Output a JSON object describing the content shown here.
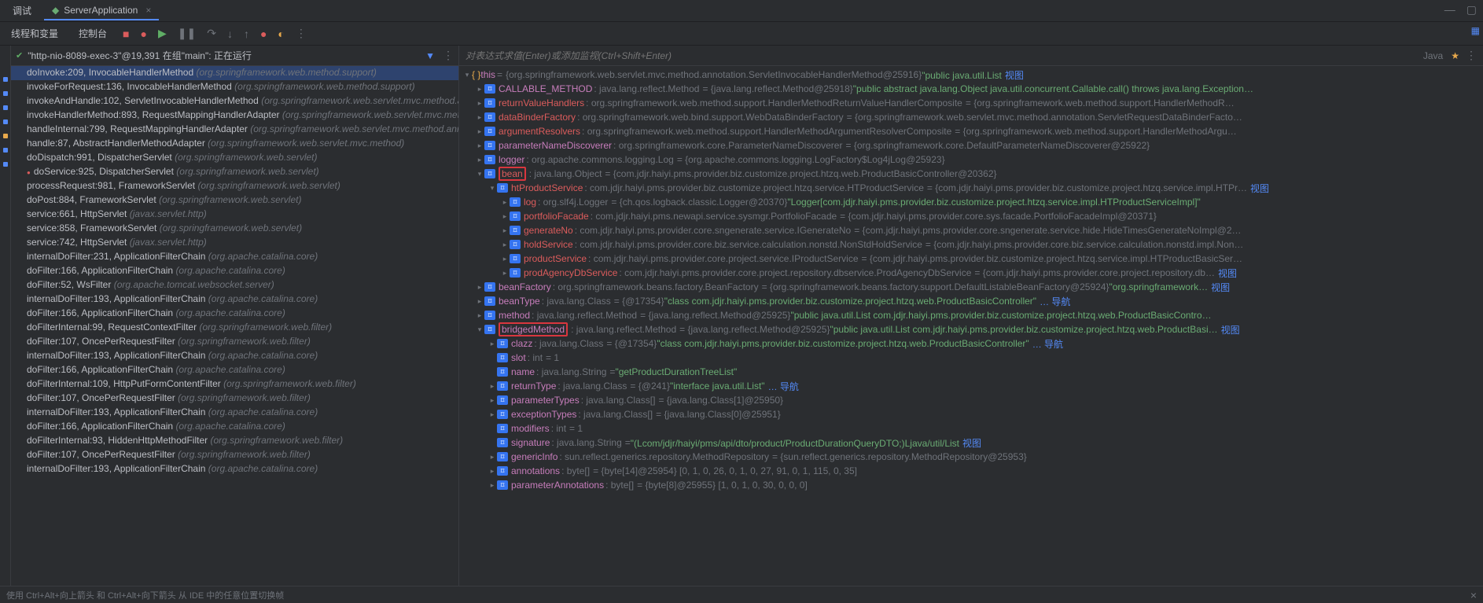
{
  "tabs": {
    "debug_label": "调试",
    "file_label": "ServerApplication"
  },
  "toolbar": {
    "vars_tab": "线程和变量",
    "console_tab": "控制台"
  },
  "thread": {
    "name": "\"http-nio-8089-exec-3\"@19,391 在组\"main\": 正在运行"
  },
  "frames": [
    {
      "m": "doInvoke:209, InvocableHandlerMethod",
      "l": "(org.springframework.web.method.support)",
      "sel": true
    },
    {
      "m": "invokeForRequest:136, InvocableHandlerMethod",
      "l": "(org.springframework.web.method.support)"
    },
    {
      "m": "invokeAndHandle:102, ServletInvocableHandlerMethod",
      "l": "(org.springframework.web.servlet.mvc.method.an…"
    },
    {
      "m": "invokeHandlerMethod:893, RequestMappingHandlerAdapter",
      "l": "(org.springframework.web.servlet.mvc.meth…"
    },
    {
      "m": "handleInternal:799, RequestMappingHandlerAdapter",
      "l": "(org.springframework.web.servlet.mvc.method.ann…"
    },
    {
      "m": "handle:87, AbstractHandlerMethodAdapter",
      "l": "(org.springframework.web.servlet.mvc.method)"
    },
    {
      "m": "doDispatch:991, DispatcherServlet",
      "l": "(org.springframework.web.servlet)"
    },
    {
      "m": "doService:925, DispatcherServlet",
      "l": "(org.springframework.web.servlet)",
      "red": true
    },
    {
      "m": "processRequest:981, FrameworkServlet",
      "l": "(org.springframework.web.servlet)"
    },
    {
      "m": "doPost:884, FrameworkServlet",
      "l": "(org.springframework.web.servlet)"
    },
    {
      "m": "service:661, HttpServlet",
      "l": "(javax.servlet.http)"
    },
    {
      "m": "service:858, FrameworkServlet",
      "l": "(org.springframework.web.servlet)"
    },
    {
      "m": "service:742, HttpServlet",
      "l": "(javax.servlet.http)"
    },
    {
      "m": "internalDoFilter:231, ApplicationFilterChain",
      "l": "(org.apache.catalina.core)"
    },
    {
      "m": "doFilter:166, ApplicationFilterChain",
      "l": "(org.apache.catalina.core)"
    },
    {
      "m": "doFilter:52, WsFilter",
      "l": "(org.apache.tomcat.websocket.server)"
    },
    {
      "m": "internalDoFilter:193, ApplicationFilterChain",
      "l": "(org.apache.catalina.core)"
    },
    {
      "m": "doFilter:166, ApplicationFilterChain",
      "l": "(org.apache.catalina.core)"
    },
    {
      "m": "doFilterInternal:99, RequestContextFilter",
      "l": "(org.springframework.web.filter)"
    },
    {
      "m": "doFilter:107, OncePerRequestFilter",
      "l": "(org.springframework.web.filter)"
    },
    {
      "m": "internalDoFilter:193, ApplicationFilterChain",
      "l": "(org.apache.catalina.core)"
    },
    {
      "m": "doFilter:166, ApplicationFilterChain",
      "l": "(org.apache.catalina.core)"
    },
    {
      "m": "doFilterInternal:109, HttpPutFormContentFilter",
      "l": "(org.springframework.web.filter)"
    },
    {
      "m": "doFilter:107, OncePerRequestFilter",
      "l": "(org.springframework.web.filter)"
    },
    {
      "m": "internalDoFilter:193, ApplicationFilterChain",
      "l": "(org.apache.catalina.core)"
    },
    {
      "m": "doFilter:166, ApplicationFilterChain",
      "l": "(org.apache.catalina.core)"
    },
    {
      "m": "doFilterInternal:93, HiddenHttpMethodFilter",
      "l": "(org.springframework.web.filter)"
    },
    {
      "m": "doFilter:107, OncePerRequestFilter",
      "l": "(org.springframework.web.filter)"
    },
    {
      "m": "internalDoFilter:193, ApplicationFilterChain",
      "l": "(org.apache.catalina.core)"
    }
  ],
  "eval": {
    "placeholder": "对表达式求值(Enter)或添加监视(Ctrl+Shift+Enter)",
    "lang": "Java"
  },
  "vars": {
    "this": {
      "name": "this",
      "val": "{org.springframework.web.servlet.mvc.method.annotation.ServletInvocableHandlerMethod@25916}",
      "str": "\"public java.util.List<com.jdjr.haiyi.pms.provider.biz.customize.proj…",
      "link": "视图"
    },
    "CALLABLE_METHOD": {
      "type": ": java.lang.reflect.Method",
      "val": "= {java.lang.reflect.Method@25918}",
      "str": "\"public abstract java.lang.Object java.util.concurrent.Callable.call() throws java.lang.Exception…"
    },
    "returnValueHandlers": {
      "type": ": org.springframework.web.method.support.HandlerMethodReturnValueHandlerComposite",
      "val": "= {org.springframework.web.method.support.HandlerMethodR…"
    },
    "dataBinderFactory": {
      "type": ": org.springframework.web.bind.support.WebDataBinderFactory",
      "val": "= {org.springframework.web.servlet.mvc.method.annotation.ServletRequestDataBinderFacto…"
    },
    "argumentResolvers": {
      "type": ": org.springframework.web.method.support.HandlerMethodArgumentResolverComposite",
      "val": "= {org.springframework.web.method.support.HandlerMethodArgu…"
    },
    "parameterNameDiscoverer": {
      "type": ": org.springframework.core.ParameterNameDiscoverer",
      "val": "= {org.springframework.core.DefaultParameterNameDiscoverer@25922}"
    },
    "logger": {
      "type": ": org.apache.commons.logging.Log",
      "val": "= {org.apache.commons.logging.LogFactory$Log4jLog@25923}"
    },
    "bean": {
      "type": ": java.lang.Object",
      "val": "= {com.jdjr.haiyi.pms.provider.biz.customize.project.htzq.web.ProductBasicController@20362}"
    },
    "htProductService": {
      "type": ": com.jdjr.haiyi.pms.provider.biz.customize.project.htzq.service.HTProductService",
      "val": "= {com.jdjr.haiyi.pms.provider.biz.customize.project.htzq.service.impl.HTPr…",
      "link": "视图"
    },
    "log": {
      "type": ": org.slf4j.Logger",
      "val": "= {ch.qos.logback.classic.Logger@20370}",
      "str": "\"Logger[com.jdjr.haiyi.pms.provider.biz.customize.project.htzq.service.impl.HTProductServiceImpl]\""
    },
    "portfolioFacade": {
      "type": ": com.jdjr.haiyi.pms.newapi.service.sysmgr.PortfolioFacade",
      "val": "= {com.jdjr.haiyi.pms.provider.core.sys.facade.PortfolioFacadeImpl@20371}"
    },
    "generateNo": {
      "type": ": com.jdjr.haiyi.pms.provider.core.sngenerate.service.IGenerateNo",
      "val": "= {com.jdjr.haiyi.pms.provider.core.sngenerate.service.hide.HideTimesGenerateNoImpl@2…"
    },
    "holdService": {
      "type": ": com.jdjr.haiyi.pms.provider.core.biz.service.calculation.nonstd.NonStdHoldService",
      "val": "= {com.jdjr.haiyi.pms.provider.core.biz.service.calculation.nonstd.impl.Non…"
    },
    "productService": {
      "type": ": com.jdjr.haiyi.pms.provider.core.project.service.IProductService",
      "val": "= {com.jdjr.haiyi.pms.provider.biz.customize.project.htzq.service.impl.HTProductBasicSer…"
    },
    "prodAgencyDbService": {
      "type": ": com.jdjr.haiyi.pms.provider.core.project.repository.dbservice.ProdAgencyDbService",
      "val": "= {com.jdjr.haiyi.pms.provider.core.project.repository.db…",
      "link": "视图"
    },
    "beanFactory": {
      "type": ": org.springframework.beans.factory.BeanFactory",
      "val": "= {org.springframework.beans.factory.support.DefaultListableBeanFactory@25924}",
      "str": "\"org.springframework…",
      "link": "视图"
    },
    "beanType": {
      "type": ": java.lang.Class",
      "val": "= {@17354}",
      "str": "\"class com.jdjr.haiyi.pms.provider.biz.customize.project.htzq.web.ProductBasicController\"",
      "nav": "… 导航"
    },
    "method": {
      "type": ": java.lang.reflect.Method",
      "val": "= {java.lang.reflect.Method@25925}",
      "str": "\"public java.util.List com.jdjr.haiyi.pms.provider.biz.customize.project.htzq.web.ProductBasicContro…"
    },
    "bridgedMethod": {
      "type": ": java.lang.reflect.Method",
      "val": "= {java.lang.reflect.Method@25925}",
      "str": "\"public java.util.List com.jdjr.haiyi.pms.provider.biz.customize.project.htzq.web.ProductBasi…",
      "link": "视图"
    },
    "clazz": {
      "type": ": java.lang.Class",
      "val": "= {@17354}",
      "str": "\"class com.jdjr.haiyi.pms.provider.biz.customize.project.htzq.web.ProductBasicController\"",
      "nav": "… 导航"
    },
    "slot": {
      "type": ": int",
      "val": "= 1"
    },
    "name": {
      "type": ": java.lang.String",
      "val": "=",
      "str": "\"getProductDurationTreeList\""
    },
    "returnType": {
      "type": ": java.lang.Class",
      "val": "= {@241}",
      "str": "\"interface java.util.List\"",
      "nav": "… 导航"
    },
    "parameterTypes": {
      "type": ": java.lang.Class[]",
      "val": "= {java.lang.Class[1]@25950}"
    },
    "exceptionTypes": {
      "type": ": java.lang.Class[]",
      "val": "= {java.lang.Class[0]@25951}"
    },
    "modifiers": {
      "type": ": int",
      "val": "= 1"
    },
    "signature": {
      "type": ": java.lang.String",
      "val": "=",
      "str": "\"(Lcom/jdjr/haiyi/pms/api/dto/product/ProductDurationQueryDTO;)Ljava/util/List<Lcom/jdjr/haiyi/pms/provider/biz/customize/project/htzq/…",
      "link": "视图"
    },
    "genericInfo": {
      "type": ": sun.reflect.generics.repository.MethodRepository",
      "val": "= {sun.reflect.generics.repository.MethodRepository@25953}"
    },
    "annotations": {
      "type": ": byte[]",
      "val": "= {byte[14]@25954} [0, 1, 0, 26, 0, 1, 0, 27, 91, 0, 1, 115, 0, 35]"
    },
    "parameterAnnotations": {
      "type": ": byte[]",
      "val": "= {byte[8]@25955} [1, 0, 1, 0, 30, 0, 0, 0]"
    }
  },
  "status": {
    "hint": "使用 Ctrl+Alt+向上箭头 和 Ctrl+Alt+向下箭头 从 IDE 中的任意位置切换帧"
  }
}
